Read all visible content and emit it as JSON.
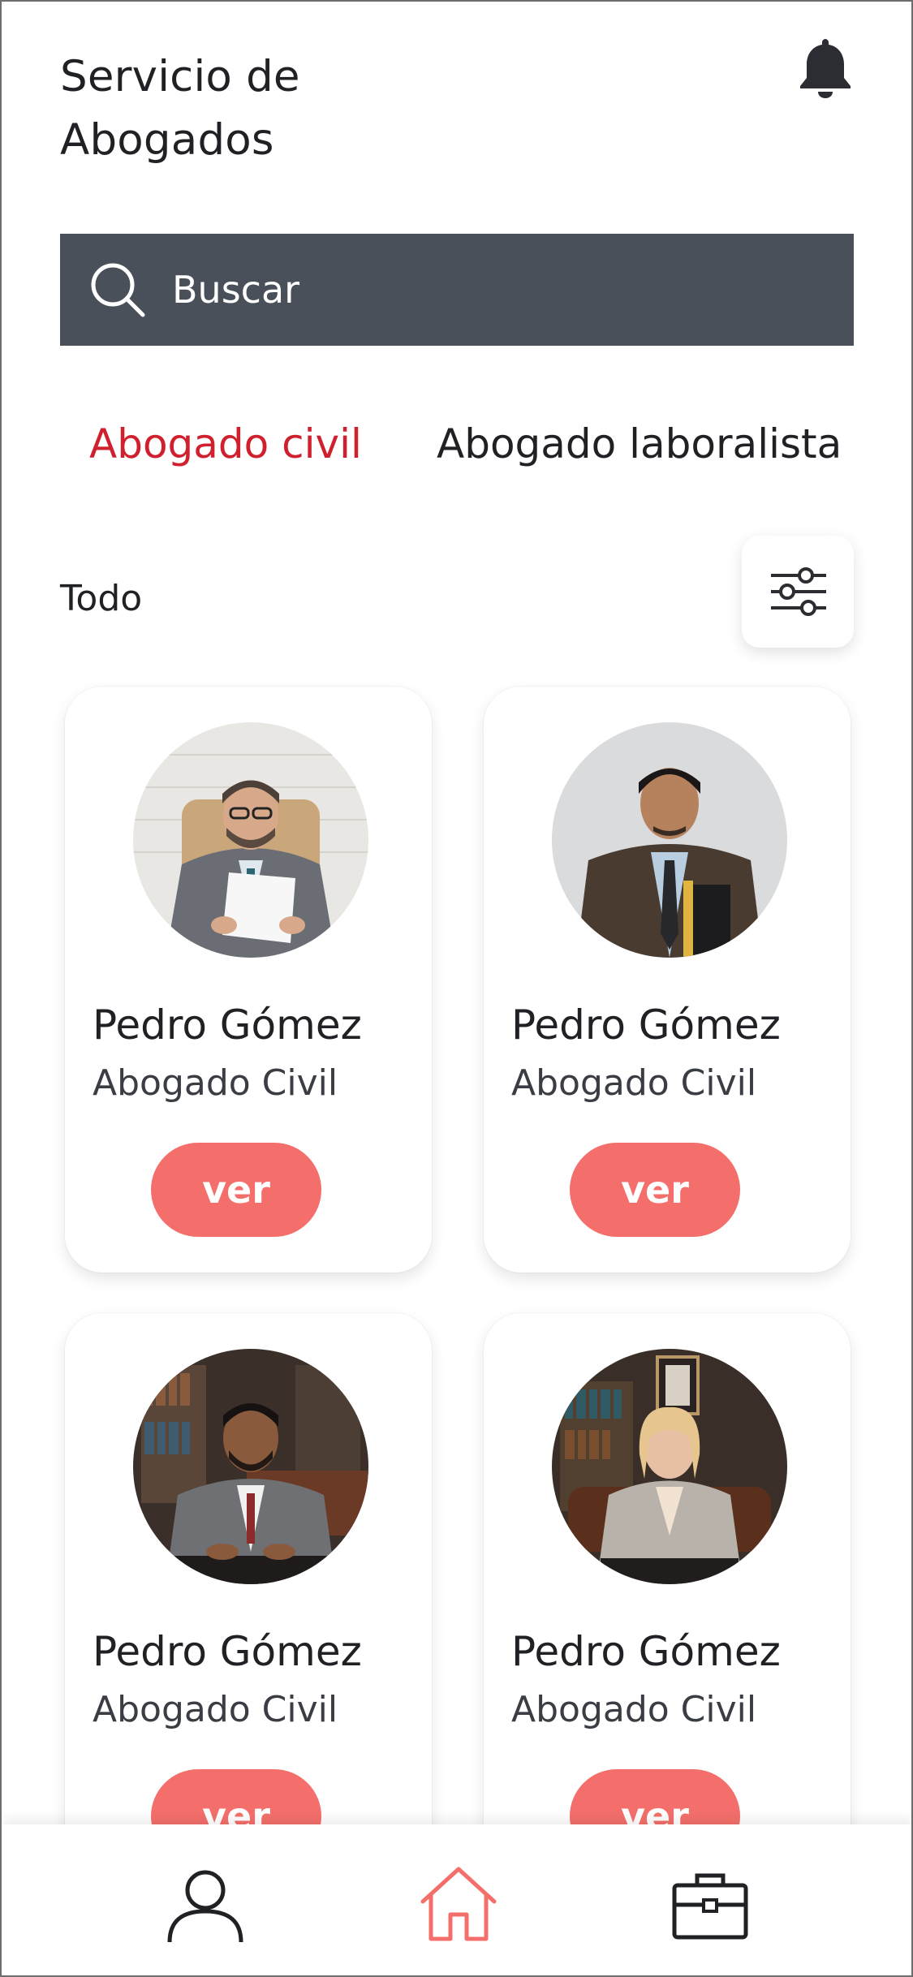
{
  "header": {
    "title_line1": "Servicio de",
    "title_line2": "Abogados"
  },
  "search": {
    "placeholder": "Buscar"
  },
  "tabs": [
    {
      "label": "Abogado civil",
      "active": true
    },
    {
      "label": "Abogado laboralista",
      "active": false
    }
  ],
  "filter": {
    "label": "Todo"
  },
  "lawyers": [
    {
      "name": "Pedro Gómez",
      "role": "Abogado Civil",
      "button": "ver"
    },
    {
      "name": "Pedro Gómez",
      "role": "Abogado Civil",
      "button": "ver"
    },
    {
      "name": "Pedro Gómez",
      "role": "Abogado Civil",
      "button": "ver"
    },
    {
      "name": "Pedro Gómez",
      "role": "Abogado Civil",
      "button": "ver"
    }
  ],
  "nav": [
    {
      "icon": "user-icon",
      "active": false
    },
    {
      "icon": "home-icon",
      "active": true
    },
    {
      "icon": "briefcase-icon",
      "active": false
    }
  ],
  "colors": {
    "accent": "#f46f6b",
    "active_tab": "#d0202e",
    "search_bg": "#495059",
    "text": "#1f2125"
  }
}
